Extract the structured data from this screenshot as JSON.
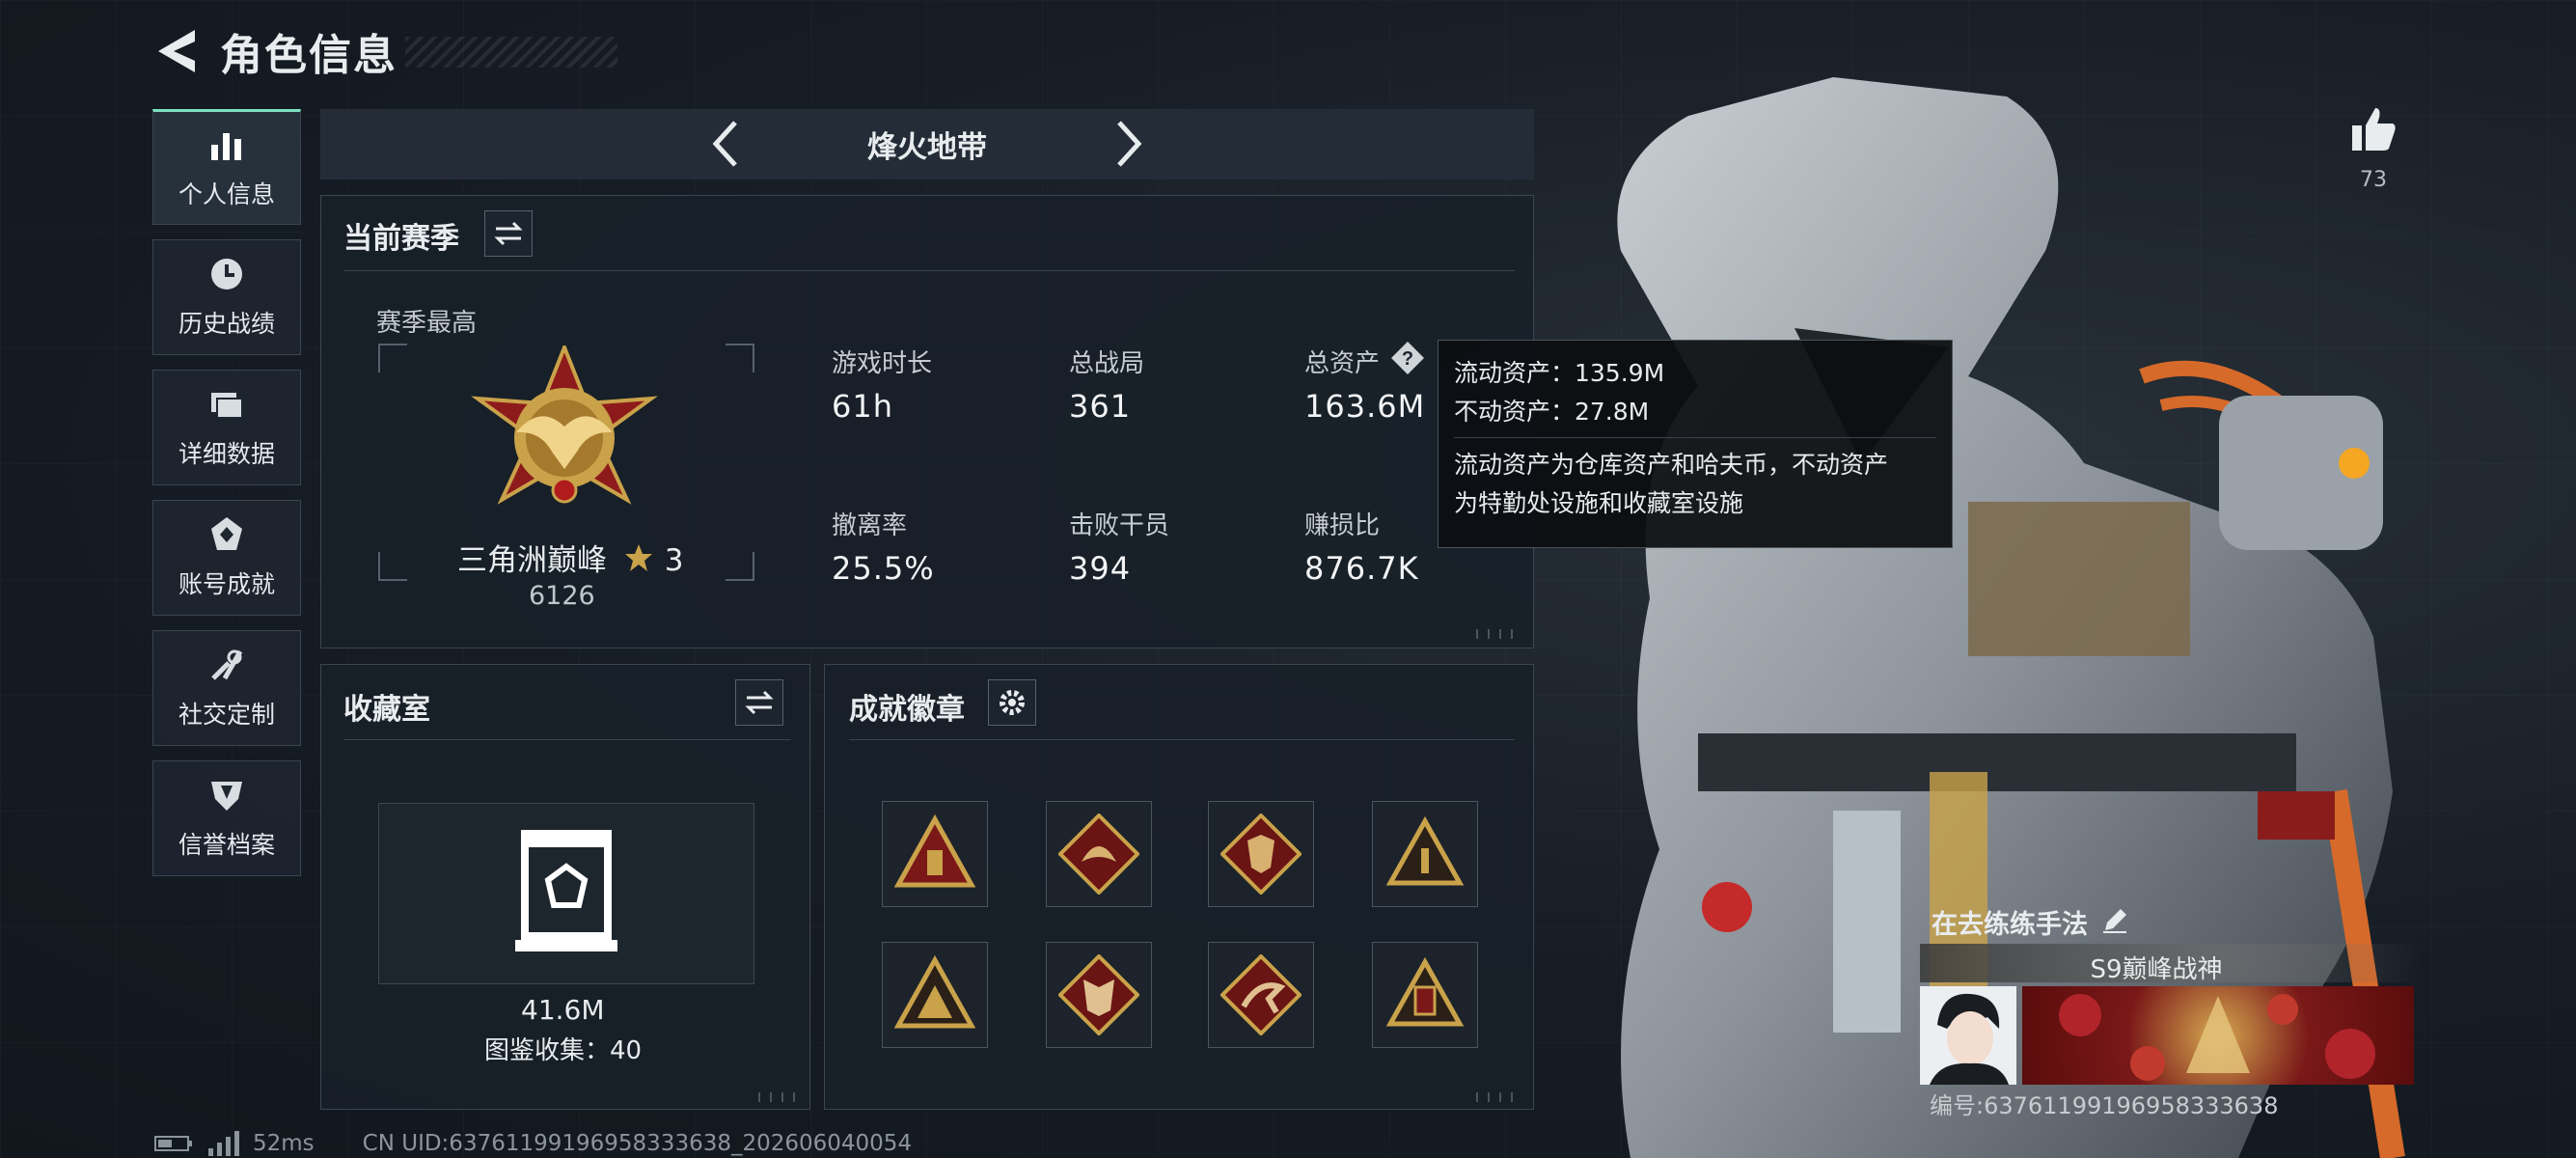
{
  "header": {
    "title": "角色信息"
  },
  "sidebar": {
    "items": [
      {
        "label": "个人信息",
        "icon": "bar-chart-icon",
        "active": true
      },
      {
        "label": "历史战绩",
        "icon": "clock-icon",
        "active": false
      },
      {
        "label": "详细数据",
        "icon": "folder-icon",
        "active": false
      },
      {
        "label": "账号成就",
        "icon": "achievement-icon",
        "active": false
      },
      {
        "label": "社交定制",
        "icon": "wrench-icon",
        "active": false
      },
      {
        "label": "信誉档案",
        "icon": "shield-icon",
        "active": false
      }
    ]
  },
  "mode_nav": {
    "title": "烽火地带"
  },
  "season": {
    "title": "当前赛季",
    "best_label": "赛季最高",
    "rank_name": "三角洲巅峰",
    "rank_stars": "3",
    "rank_score": "6126",
    "stats": [
      {
        "label": "游戏时长",
        "value": "61h"
      },
      {
        "label": "总战局",
        "value": "361"
      },
      {
        "label": "总资产",
        "value": "163.6M"
      },
      {
        "label": "撤离率",
        "value": "25.5%"
      },
      {
        "label": "击败干员",
        "value": "394"
      },
      {
        "label": "赚损比",
        "value": "876.7K"
      }
    ]
  },
  "tooltip": {
    "liquid": "流动资产：135.9M",
    "fixed": "不动资产：27.8M",
    "note_line1": "流动资产为仓库资产和哈夫币，不动资产",
    "note_line2": "为特勤处设施和收藏室设施"
  },
  "collection": {
    "title": "收藏室",
    "value": "41.6M",
    "count": "图鉴收集：40"
  },
  "achievements": {
    "title": "成就徽章",
    "badges": [
      "triangle-badge-icon",
      "dragon-badge-icon",
      "wolf-badge-icon",
      "pyramid-badge-icon",
      "warrior-badge-icon",
      "wolf-head-badge-icon",
      "runner-badge-icon",
      "tower-badge-icon"
    ]
  },
  "likes": {
    "count": "73"
  },
  "player_card": {
    "name": "在去练练手法",
    "title": "S9巅峰战神",
    "uid": "编号:637611991969583336​38"
  },
  "status_bar": {
    "ping": "52ms",
    "uid": "CN UID:6376119919695833363​8_202606040054"
  },
  "colors": {
    "accent": "#7fe0c0",
    "gold": "#c9a24a",
    "panel": "#18202a"
  }
}
